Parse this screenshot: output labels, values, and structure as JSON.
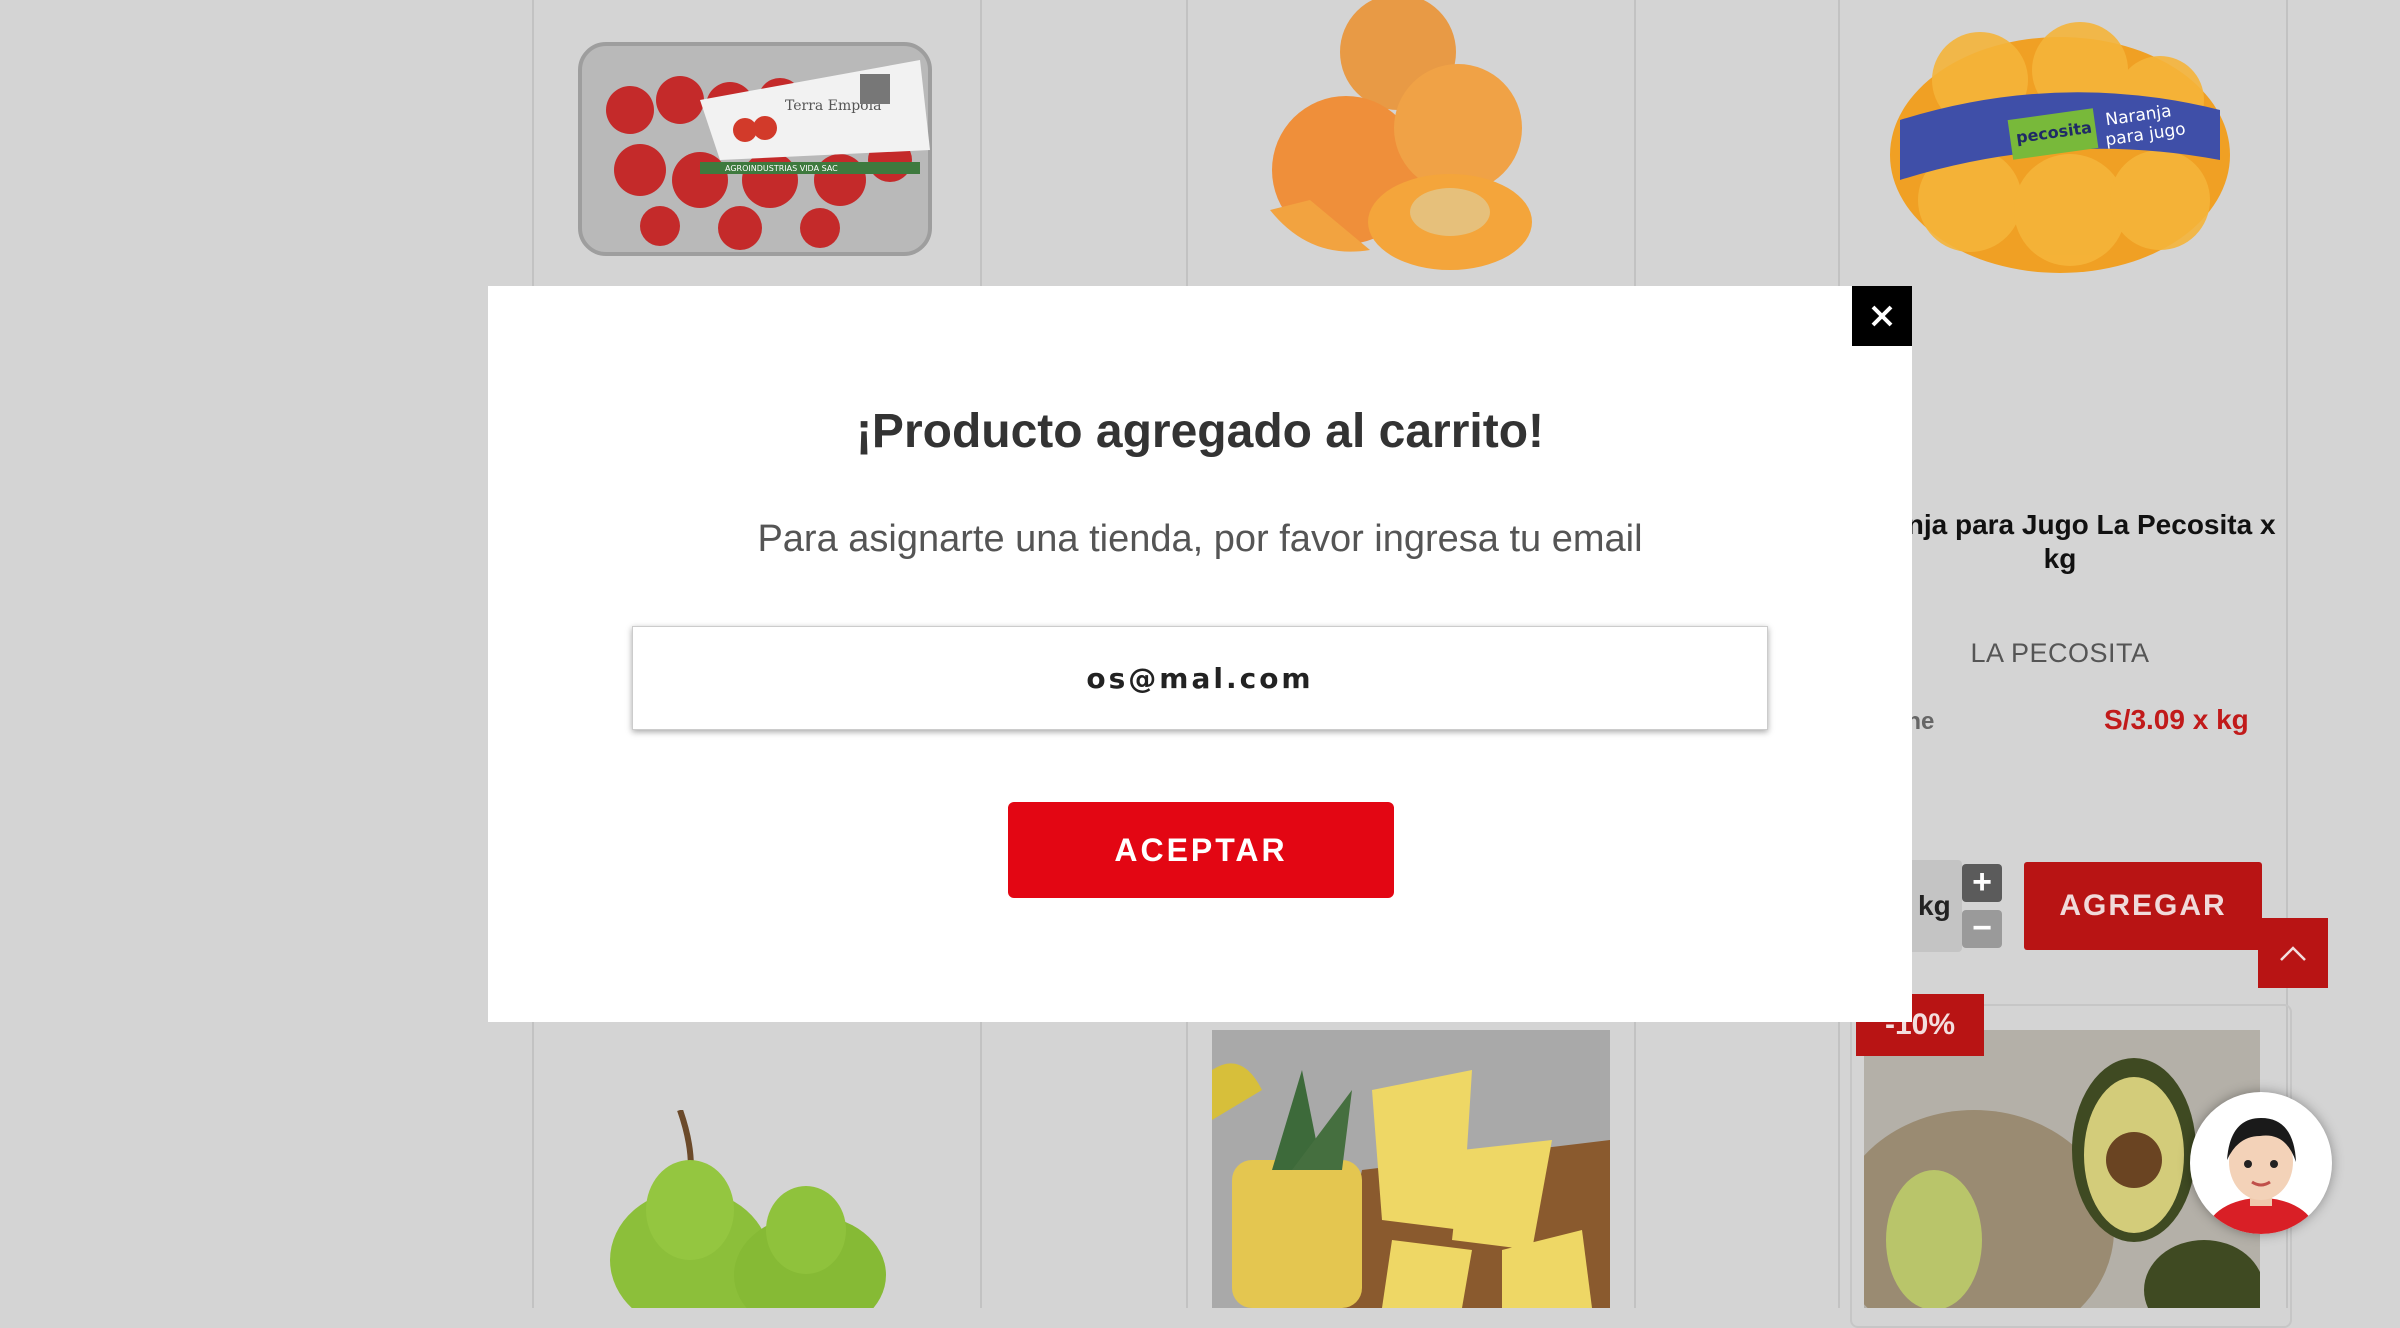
{
  "products": {
    "orange": {
      "name": "Naranja para Jugo La Pecosita x kg",
      "brand": "LA PECOSITA",
      "availability": "line",
      "price": "S/3.09 x kg",
      "qty_unit": "kg",
      "add_label": "AGREGAR"
    },
    "avocado": {
      "discount": "-10%"
    },
    "strawberry_tag": "Terra Empoia",
    "strawberry_company": "AGROINDUSTRIAS VIDA SAC",
    "orange_bag_labels": [
      "Naranja",
      "para jugo",
      "pecosita"
    ]
  },
  "modal": {
    "title": "¡Producto agregado al carrito!",
    "subtitle": "Para asignarte una tienda, por favor ingresa tu email",
    "email_value": "os@mal.com",
    "accept_label": "ACEPTAR"
  },
  "colors": {
    "brand_red": "#e30613",
    "dim_red": "#b81414",
    "overlay_bg": "#d4d4d4"
  },
  "icons": {
    "close": "close-icon",
    "scroll_top": "chevron-up-icon",
    "stepper_plus": "plus-icon",
    "stepper_minus": "minus-icon"
  }
}
